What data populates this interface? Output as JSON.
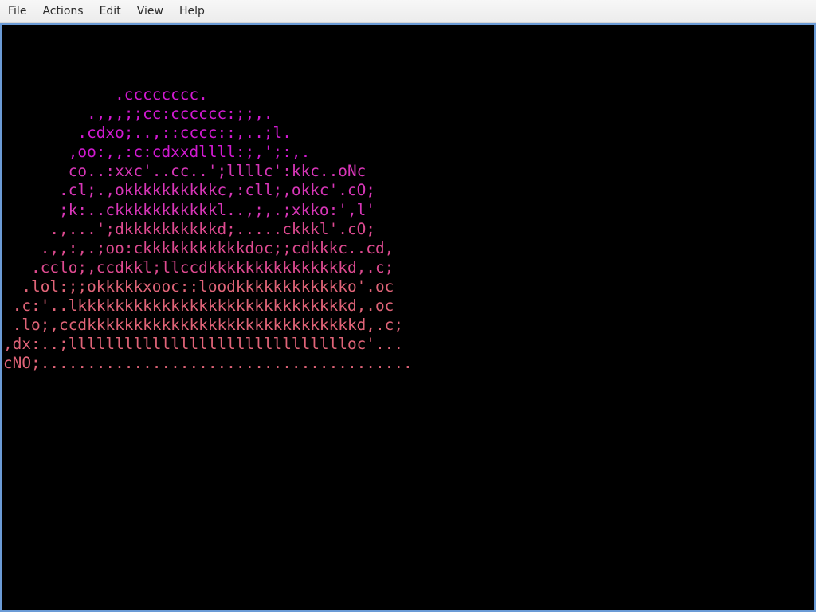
{
  "menubar": {
    "items": [
      "File",
      "Actions",
      "Edit",
      "View",
      "Help"
    ]
  },
  "terminal": {
    "colors": {
      "background": "#000000",
      "border": "#6b9bd6",
      "magenta": "#d21ad2",
      "magenta_pink": "#d836b8",
      "pink": "#de4a90",
      "rose": "#e06478"
    },
    "ascii_art": [
      {
        "text": "            .cccccccc.",
        "color": "#d21ad2"
      },
      {
        "text": "         .,,,;;cc:cccccc:;;,.",
        "color": "#d21ad2"
      },
      {
        "text": "        .cdxo;..,::cccc::,..;l.",
        "color": "#d21ad2"
      },
      {
        "text": "       ,oo:,,:c:cdxxdllll:;,';:,.",
        "color": "#d21ad2"
      },
      {
        "text": "       co..:xxc'..cc..';llllc':kkc..oNc",
        "color": "#d836b8"
      },
      {
        "text": "      .cl;.,okkkkkkkkkkc,:cll;,okkc'.cO;",
        "color": "#d836b8"
      },
      {
        "text": "      ;k:..ckkkkkkkkkkkl..,;,.;xkko:',l'",
        "color": "#d836b8"
      },
      {
        "text": "     .,...';dkkkkkkkkkkd;.....ckkkl'.cO;",
        "color": "#de4a90"
      },
      {
        "text": "    .,,:,.;oo:ckkkkkkkkkkkdoc;;cdkkkc..cd,",
        "color": "#de4a90"
      },
      {
        "text": "   .cclo;,ccdkkl;llccdkkkkkkkkkkkkkkkd,.c;",
        "color": "#de4a90"
      },
      {
        "text": "  .lol:;;okkkkkxooc::loodkkkkkkkkkkkko'.oc",
        "color": "#e06478"
      },
      {
        "text": " .c:'..lkkkkkkkkkkkkkkkkkkkkkkkkkkkkkd,.oc",
        "color": "#e06478"
      },
      {
        "text": " .lo;,ccdkkkkkkkkkkkkkkkkkkkkkkkkkkkkkd,.c;",
        "color": "#e06478"
      },
      {
        "text": ",dx:..;lllllllllllllllllllllllllllllloc'...",
        "color": "#e06478"
      },
      {
        "text": "cNO;........................................",
        "color": "#e06478"
      }
    ]
  }
}
